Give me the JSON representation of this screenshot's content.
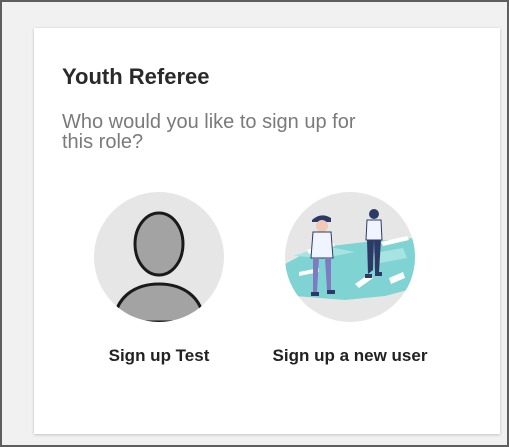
{
  "card": {
    "title": "Youth Referee",
    "subtitle": "Who would you like to sign up for this role?"
  },
  "options": [
    {
      "label": "Sign up Test",
      "icon": "person-placeholder-icon"
    },
    {
      "label": "Sign up a new user",
      "icon": "new-user-illustration-icon"
    }
  ],
  "colors": {
    "card_bg": "#ffffff",
    "page_bg": "#f1f1f1",
    "title_text": "#2a2a2a",
    "subtitle_text": "#7a7a7a",
    "illustration_teal": "#7fd3d2",
    "illustration_navy": "#2d3a66"
  }
}
